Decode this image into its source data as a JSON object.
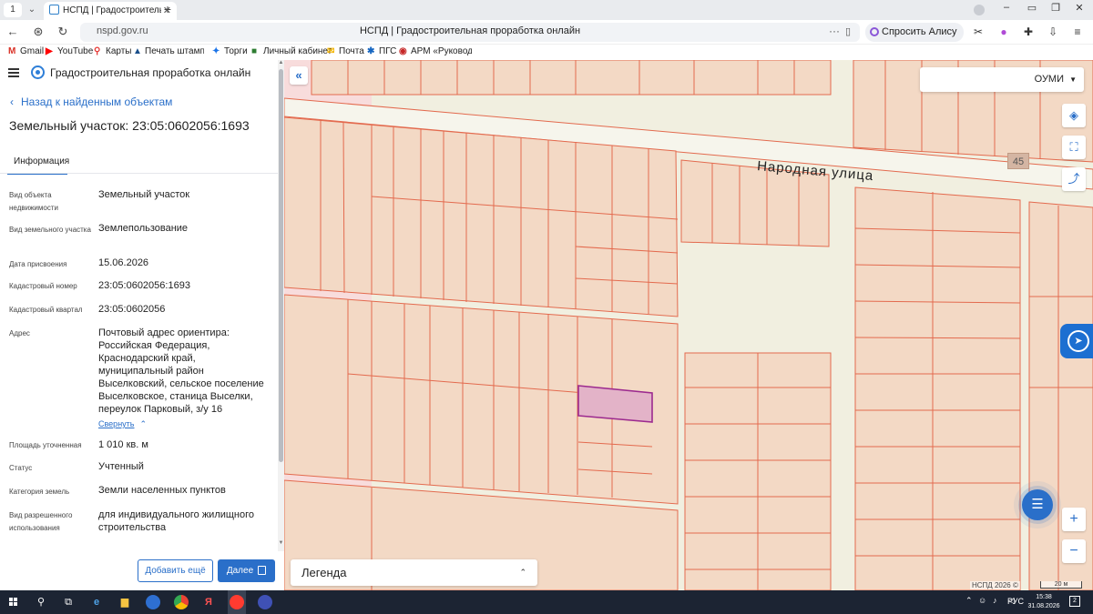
{
  "browser": {
    "tab_count": "1",
    "tab_title": "НСПД | Градостроительн",
    "url_domain": "nspd.gov.ru",
    "page_title": "НСПД | Градостроительная проработка онлайн",
    "alice_label": "Спросить Алису AI"
  },
  "bookmarks": [
    {
      "label": "Gmail",
      "icon": "gmail-icon",
      "color": "#d93025"
    },
    {
      "label": "YouTube",
      "icon": "youtube-icon",
      "color": "#ff0000"
    },
    {
      "label": "Карты",
      "icon": "maps-pin-icon",
      "color": "#e53935"
    },
    {
      "label": "Печать штампа с",
      "icon": "bookmark-triangle-icon",
      "color": "#1a4f8b"
    },
    {
      "label": "Торги",
      "icon": "bookmark-star-icon",
      "color": "#1a73e8"
    },
    {
      "label": "Личный кабинет",
      "icon": "bookmark-cabinet-icon",
      "color": "#2e7d32"
    },
    {
      "label": "Почта",
      "icon": "mail-icon",
      "color": "#f4b400"
    },
    {
      "label": "ПГС",
      "icon": "bookmark-pgs-icon",
      "color": "#1565c0"
    },
    {
      "label": "АРМ «Руководит",
      "icon": "bookmark-arm-icon",
      "color": "#c62828"
    }
  ],
  "app": {
    "title": "Градостроительная проработка онлайн",
    "back_label": "Назад к найденным объектам",
    "object_title": "Земельный участок: 23:05:0602056:1693",
    "tab_info": "Информация"
  },
  "properties": [
    {
      "label": "Вид объекта недвижимости",
      "value": "Земельный участок"
    },
    {
      "label": "Вид земельного участка",
      "value": "Землепользование"
    },
    {
      "label": "Дата присвоения",
      "value": "15.06.2026"
    },
    {
      "label": "Кадастровый номер",
      "value": "23:05:0602056:1693"
    },
    {
      "label": "Кадастровый квартал",
      "value": "23:05:0602056"
    },
    {
      "label": "Адрес",
      "value": "Почтовый адрес ориентира: Российская Федерация, Краснодарский край, муниципальный район Выселковский, сельское поселение Выселковское, станица Выселки, переулок Парковый, з/у 16"
    },
    {
      "label": "Площадь уточненная",
      "value": "1 010 кв. м"
    },
    {
      "label": "Статус",
      "value": "Учтенный"
    },
    {
      "label": "Категория земель",
      "value": "Земли населенных пунктов"
    },
    {
      "label": "Вид разрешенного использования",
      "value": "для индивидуального жилищного строительства"
    }
  ],
  "collapse_label": "Свернуть",
  "actions": {
    "add_more": "Добавить ещё",
    "next": "Далее"
  },
  "map": {
    "layer_select": "ОУМИ",
    "street_label": "Народная улица",
    "house_number": "45",
    "legend_label": "Легенда",
    "copyright": "НСПД 2026 ©",
    "scale_label": "20 м",
    "colors": {
      "background": "#f1efe0",
      "parcel_fill": "#f3d9c5",
      "parcel_line": "#e36a4e",
      "selected_fill": "#e3b3c8",
      "selected_line": "#9c2a8f",
      "pink_zone": "#f8dcdc"
    }
  },
  "taskbar": {
    "lang": "РУС",
    "time": "15:38",
    "date": "31.08.2026",
    "notifications": "2"
  }
}
